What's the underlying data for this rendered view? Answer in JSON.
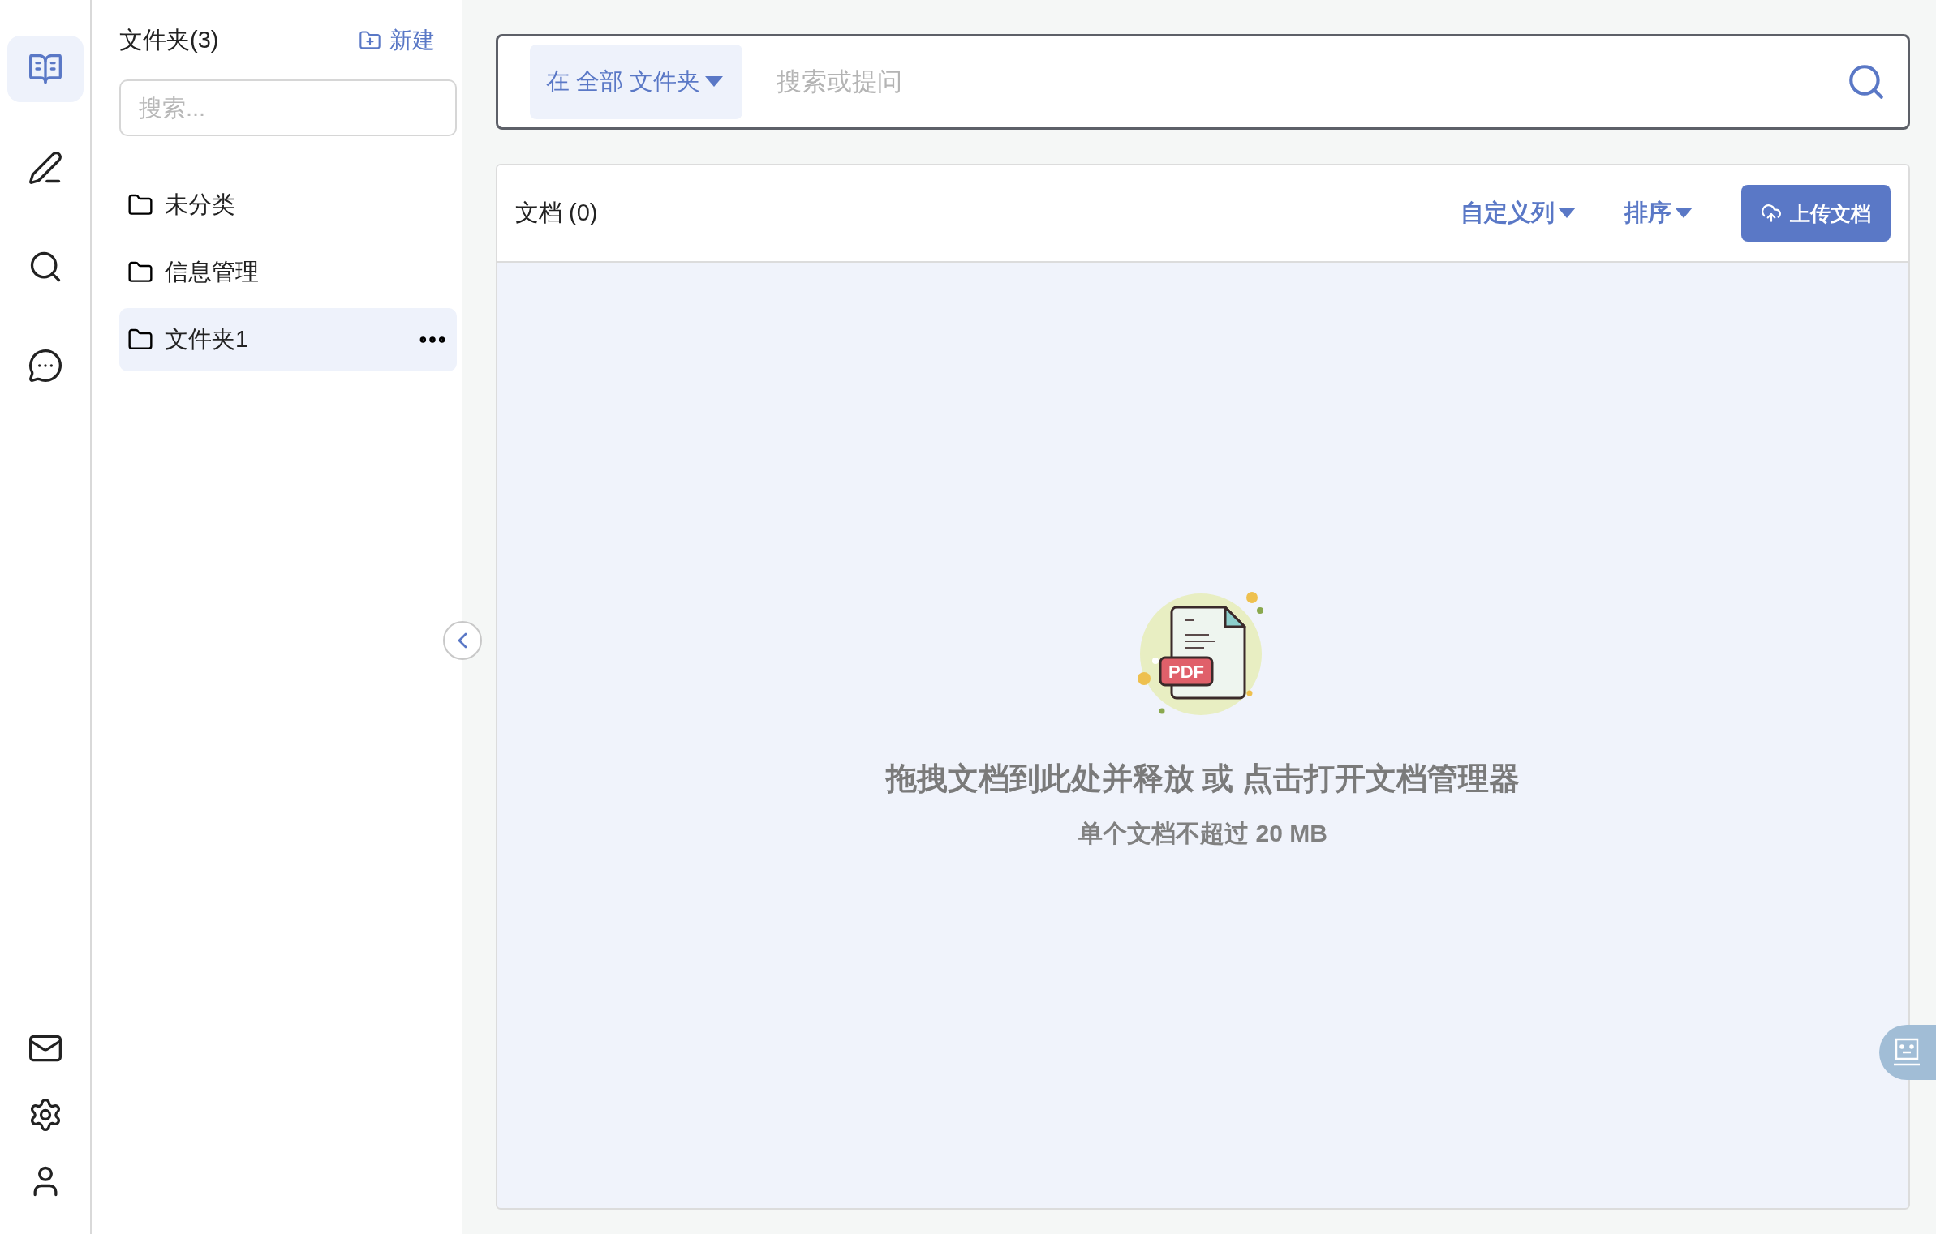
{
  "rail": {
    "top": [
      {
        "kind": "library",
        "selected": true
      },
      {
        "kind": "write",
        "selected": false
      },
      {
        "kind": "search",
        "selected": false
      },
      {
        "kind": "chat",
        "selected": false
      }
    ],
    "bottom": [
      {
        "kind": "mail"
      },
      {
        "kind": "settings"
      },
      {
        "kind": "user"
      }
    ]
  },
  "folders": {
    "title": "文件夹(3)",
    "new_button": "新建",
    "search": {
      "placeholder": "搜索..."
    },
    "items": [
      {
        "label": "未分类",
        "selected": false
      },
      {
        "label": "信息管理",
        "selected": false
      },
      {
        "label": "文件夹1",
        "selected": true
      }
    ]
  },
  "search": {
    "scope": "在 全部 文件夹",
    "placeholder": "搜索或提问"
  },
  "documents": {
    "title": "文档 (0)",
    "custom_columns": "自定义列",
    "sort": "排序",
    "upload": "上传文档",
    "empty": {
      "badge": "PDF",
      "headline": "拖拽文档到此处并释放 或 点击打开文档管理器",
      "note": "单个文档不超过 20 MB"
    }
  }
}
